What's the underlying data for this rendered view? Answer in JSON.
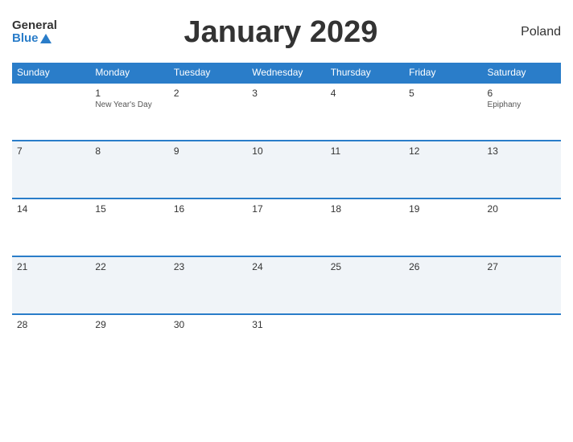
{
  "header": {
    "logo_general": "General",
    "logo_blue": "Blue",
    "title": "January 2029",
    "country": "Poland"
  },
  "weekdays": [
    "Sunday",
    "Monday",
    "Tuesday",
    "Wednesday",
    "Thursday",
    "Friday",
    "Saturday"
  ],
  "weeks": [
    [
      {
        "day": "",
        "holiday": ""
      },
      {
        "day": "1",
        "holiday": "New Year's Day"
      },
      {
        "day": "2",
        "holiday": ""
      },
      {
        "day": "3",
        "holiday": ""
      },
      {
        "day": "4",
        "holiday": ""
      },
      {
        "day": "5",
        "holiday": ""
      },
      {
        "day": "6",
        "holiday": "Epiphany"
      }
    ],
    [
      {
        "day": "7",
        "holiday": ""
      },
      {
        "day": "8",
        "holiday": ""
      },
      {
        "day": "9",
        "holiday": ""
      },
      {
        "day": "10",
        "holiday": ""
      },
      {
        "day": "11",
        "holiday": ""
      },
      {
        "day": "12",
        "holiday": ""
      },
      {
        "day": "13",
        "holiday": ""
      }
    ],
    [
      {
        "day": "14",
        "holiday": ""
      },
      {
        "day": "15",
        "holiday": ""
      },
      {
        "day": "16",
        "holiday": ""
      },
      {
        "day": "17",
        "holiday": ""
      },
      {
        "day": "18",
        "holiday": ""
      },
      {
        "day": "19",
        "holiday": ""
      },
      {
        "day": "20",
        "holiday": ""
      }
    ],
    [
      {
        "day": "21",
        "holiday": ""
      },
      {
        "day": "22",
        "holiday": ""
      },
      {
        "day": "23",
        "holiday": ""
      },
      {
        "day": "24",
        "holiday": ""
      },
      {
        "day": "25",
        "holiday": ""
      },
      {
        "day": "26",
        "holiday": ""
      },
      {
        "day": "27",
        "holiday": ""
      }
    ],
    [
      {
        "day": "28",
        "holiday": ""
      },
      {
        "day": "29",
        "holiday": ""
      },
      {
        "day": "30",
        "holiday": ""
      },
      {
        "day": "31",
        "holiday": ""
      },
      {
        "day": "",
        "holiday": ""
      },
      {
        "day": "",
        "holiday": ""
      },
      {
        "day": "",
        "holiday": ""
      }
    ]
  ]
}
